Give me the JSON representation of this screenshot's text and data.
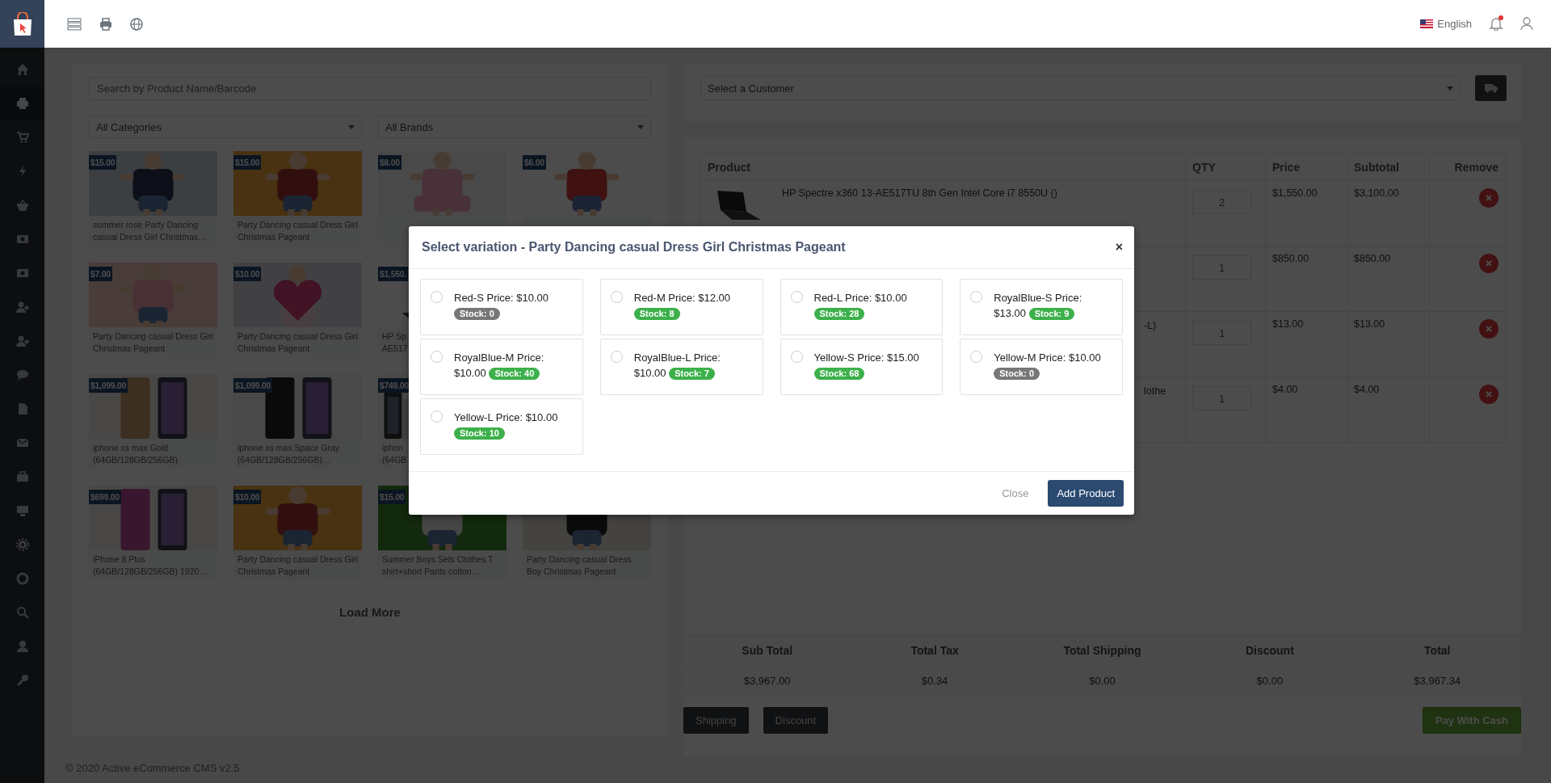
{
  "topbar": {
    "language": "English"
  },
  "sidebar": {
    "items": [
      {
        "selected": false
      },
      {
        "selected": true
      },
      {
        "selected": false
      },
      {
        "selected": false
      },
      {
        "selected": false
      },
      {
        "selected": false
      },
      {
        "selected": false
      },
      {
        "selected": false
      },
      {
        "selected": false
      },
      {
        "selected": false
      },
      {
        "selected": false
      },
      {
        "selected": false
      },
      {
        "selected": false
      },
      {
        "selected": false
      },
      {
        "selected": false
      },
      {
        "selected": false
      },
      {
        "selected": false
      },
      {
        "selected": false
      },
      {
        "selected": false
      }
    ]
  },
  "product_panel": {
    "search": {
      "placeholder": "Search by Product Name/Barcode"
    },
    "category_select": {
      "value": "All Categories"
    },
    "brand_select": {
      "value": "All Brands"
    },
    "tiles": [
      {
        "price": "$15.00",
        "name": "summer rose Party Dancing casual Dress Girl Christmas…"
      },
      {
        "price": "$15.00",
        "name": "Party Dancing casual Dress Girl Christmas Pageant"
      },
      {
        "price": "$8.00"
      },
      {
        "price": "$6.00"
      },
      {
        "price": "$7.00",
        "name": "Party Dancing casual Dress Girl Christmas Pageant"
      },
      {
        "price": "$10.00",
        "name": "Party Dancing casual Dress Girl Christmas Pageant"
      },
      {
        "price": "$1,550.",
        "name_lines": [
          "HP Sp",
          "AE517"
        ]
      },
      {
        "price": "$1,099.00",
        "name": "iphone xs max Gold (64GB/128GB/256GB)"
      },
      {
        "price": "$1,099.00",
        "name": "iphone xs max Space Gray (64GB/128GB/256GB)…"
      },
      {
        "price": "$749.00",
        "name_lines": [
          "iphon",
          "(64GB"
        ]
      },
      {
        "price": "$699.00",
        "name": "iPhone 8 Plus (64GB/128GB/256GB) 1920…"
      },
      {
        "price": "$10.00",
        "name": "Party Dancing casual Dress Girl Christmas Pageant"
      },
      {
        "price": "$15.00",
        "name": "Summer Boys Sets Clothes T shirt+short Pants cotton…"
      },
      {
        "name": "Party Dancing casual Dress Boy Christmas Pageant"
      }
    ],
    "load_more": "Load More"
  },
  "customer_select": {
    "value": "Select a Customer"
  },
  "cart": {
    "columns": [
      "Product",
      "QTY",
      "Price",
      "Subtotal",
      "Remove"
    ],
    "rows": [
      {
        "kind": "picture",
        "product": "HP Spectre x360 13-AE517TU 8th Gen Intel Core i7 8550U ()",
        "qty": "2",
        "price": "$1,550.00",
        "subtotal": "$3,100.00"
      },
      {
        "qty": "1",
        "price": "$850.00",
        "subtotal": "$850.00"
      },
      {
        "product": "-L)",
        "qty": "1",
        "price": "$13.00",
        "subtotal": "$13.00"
      },
      {
        "product": "lothe",
        "qty": "1",
        "price": "$4.00",
        "subtotal": "$4.00"
      }
    ]
  },
  "totals": {
    "columns": [
      "Sub Total",
      "Total Tax",
      "Total Shipping",
      "Discount",
      "Total"
    ],
    "values": [
      "$3,967.00",
      "$0.34",
      "$0.00",
      "$0.00",
      "$3,967.34"
    ]
  },
  "buttons": {
    "shipping": "Shipping",
    "discount": "Discount",
    "pay": "Pay With Cash"
  },
  "footer": "© 2020 Active eCommerce CMS v2.5",
  "modal": {
    "title": "Select variation - Party Dancing casual Dress Girl Christmas Pageant",
    "close": "×",
    "variations": [
      {
        "label": "Red-S Price: $10.00",
        "stock": "Stock: 0",
        "color": "#777777",
        "selected": false
      },
      {
        "label": "Red-M Price: $12.00",
        "stock": "Stock: 8",
        "color": "#3cb04a",
        "selected": false
      },
      {
        "label": "Red-L Price: $10.00",
        "stock": "Stock: 28",
        "color": "#3cb04a",
        "selected": false
      },
      {
        "label": "RoyalBlue-S Price: $13.00",
        "stock": "Stock: 9",
        "color": "#3cb04a",
        "selected": false
      },
      {
        "label": "RoyalBlue-M Price: $10.00",
        "stock": "Stock: 40",
        "color": "#3cb04a",
        "selected": false
      },
      {
        "label": "RoyalBlue-L Price: $10.00",
        "stock": "Stock: 7",
        "color": "#3cb04a",
        "selected": false
      },
      {
        "label": "Yellow-S Price: $15.00",
        "stock": "Stock: 68",
        "color": "#3cb04a",
        "selected": false
      },
      {
        "label": "Yellow-M Price: $10.00",
        "stock": "Stock: 0",
        "color": "#777777",
        "selected": false
      },
      {
        "label": "Yellow-L Price: $10.00",
        "stock": "Stock: 10",
        "color": "#3cb04a",
        "selected": false
      }
    ],
    "close_button": "Close",
    "add_button": "Add Product"
  }
}
